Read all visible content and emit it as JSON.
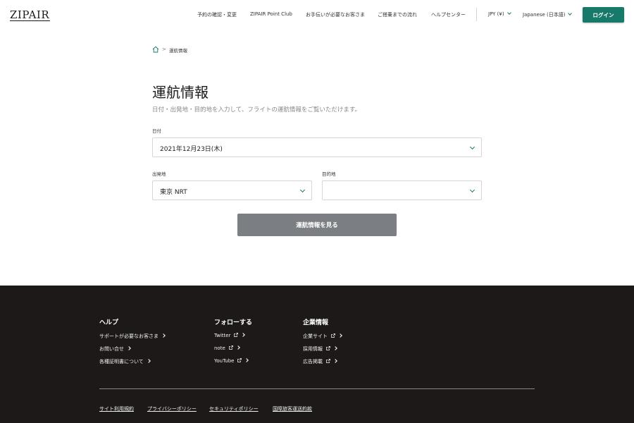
{
  "header": {
    "logo": "ZIPAIR",
    "nav": [
      "予約の確認・変更",
      "ZIPAIR Point Club",
      "お手伝いが必要なお客さま",
      "ご搭乗までの流れ",
      "ヘルプセンター"
    ],
    "currency": "JPY (¥)",
    "language": "Japanese (日本語)",
    "login": "ログイン"
  },
  "breadcrumb": {
    "current": "運航情報"
  },
  "page": {
    "title": "運航情報",
    "description": "日付・出発地・目的地を入力して、フライトの運航情報をご覧いただけます。"
  },
  "form": {
    "date_label": "日付",
    "date_value": "2021年12月23日(木)",
    "origin_label": "出発地",
    "origin_value": "東京 NRT",
    "destination_label": "目的地",
    "destination_value": "",
    "submit": "運航情報を見る"
  },
  "footer": {
    "columns": [
      {
        "title": "ヘルプ",
        "links": [
          "サポートが必要なお客さま",
          "お問い合せ",
          "各種証明書について"
        ]
      },
      {
        "title": "フォローする",
        "links": [
          "Twitter",
          "note",
          "YouTube"
        ]
      },
      {
        "title": "企業情報",
        "links": [
          "企業サイト",
          "採用情報",
          "広告掲載"
        ]
      }
    ],
    "bottom_links": [
      "サイト利用規約",
      "プライバシーポリシー",
      "セキュリティポリシー",
      "国際旅客運送約款"
    ]
  },
  "colors": {
    "brand": "#17796a",
    "submit_disabled": "#7b7e83",
    "footer_bg": "#1d1919"
  }
}
